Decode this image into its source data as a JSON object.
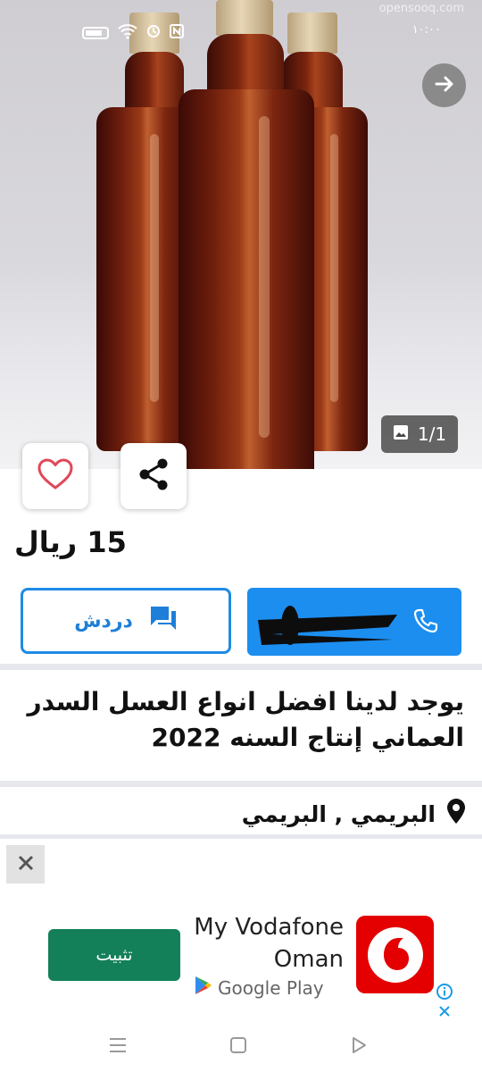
{
  "status_bar": {
    "time": "١٠:٠٠",
    "watermark": "opensooq.com",
    "icons": [
      "battery-icon",
      "wifi-icon",
      "alarm-icon",
      "nfc-icon"
    ]
  },
  "gallery": {
    "counter": "1/1",
    "next_icon": "arrow-right-icon",
    "counter_icon": "image-icon"
  },
  "actions": {
    "favorite_icon": "heart-icon",
    "share_icon": "share-icon"
  },
  "listing": {
    "price": "15 ريال",
    "title": "يوجد لدينا افضل انواع العسل السدر العماني إنتاج السنه 2022",
    "location": "البريمي , البريمي"
  },
  "contact": {
    "chat_label": "دردش",
    "chat_icon": "chat-icon",
    "call_icon": "phone-icon",
    "call_number_redacted": true
  },
  "ad": {
    "close_icon": "close-icon",
    "install_label": "تثبيت",
    "app_name_line1": "My Vodafone",
    "app_name_line2": "Oman",
    "store": "Google Play",
    "info_icon": "info-icon",
    "brand_color": "#e40000",
    "install_color": "#13805a"
  },
  "colors": {
    "accent": "#1e8be3",
    "heart": "#e0485a"
  }
}
